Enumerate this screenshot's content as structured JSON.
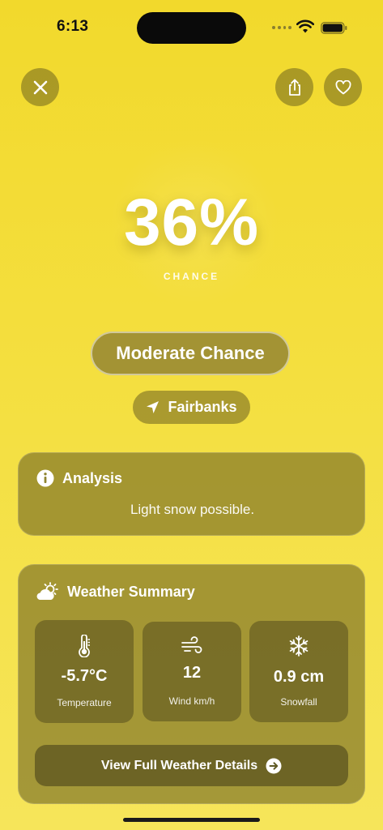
{
  "status_bar": {
    "time": "6:13"
  },
  "toolbar": {
    "close_icon": "close-icon",
    "share_icon": "share-icon",
    "favorite_icon": "heart-icon"
  },
  "probability": {
    "value": "36%",
    "label": "CHANCE",
    "fraction": 0.36
  },
  "level": {
    "label": "Moderate Chance"
  },
  "location": {
    "icon": "location-arrow-icon",
    "name": "Fairbanks"
  },
  "analysis": {
    "icon": "info-icon",
    "title": "Analysis",
    "text": "Light snow possible."
  },
  "weather_summary": {
    "icon": "partly-cloudy-icon",
    "title": "Weather Summary",
    "tiles": [
      {
        "icon": "thermometer-icon",
        "value": "-5.7°C",
        "label": "Temperature"
      },
      {
        "icon": "wind-icon",
        "value": "12",
        "label": "Wind km/h"
      },
      {
        "icon": "snowflake-icon",
        "value": "0.9 cm",
        "label": "Snowfall"
      }
    ],
    "details_button": {
      "label": "View Full Weather Details",
      "icon": "arrow-right-circle-icon"
    }
  },
  "colors": {
    "background": "#f2d92c",
    "card": "#8f8530",
    "text": "#ffffff"
  }
}
